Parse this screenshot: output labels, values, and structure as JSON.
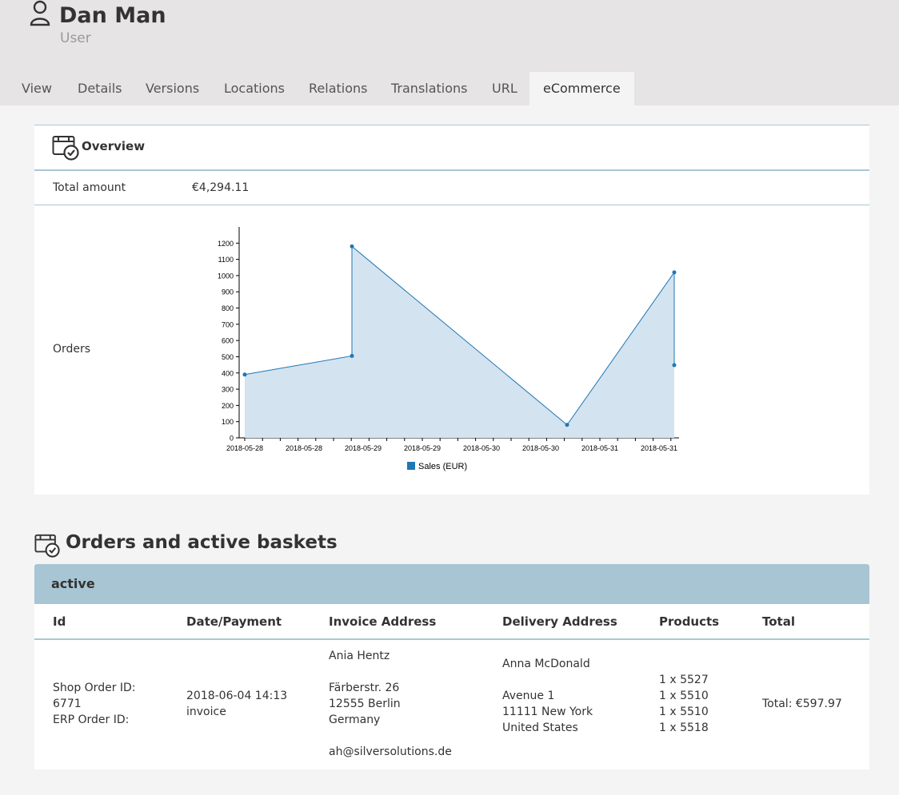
{
  "header": {
    "title": "Dan Man",
    "subtitle": "User",
    "icon": "user-icon"
  },
  "tabs": [
    {
      "label": "View",
      "active": false
    },
    {
      "label": "Details",
      "active": false
    },
    {
      "label": "Versions",
      "active": false
    },
    {
      "label": "Locations",
      "active": false
    },
    {
      "label": "Relations",
      "active": false
    },
    {
      "label": "Translations",
      "active": false
    },
    {
      "label": "URL",
      "active": false
    },
    {
      "label": "eCommerce",
      "active": true
    }
  ],
  "overview": {
    "title": "Overview",
    "total_label": "Total amount",
    "total_value": "€4,294.11",
    "orders_label": "Orders"
  },
  "chart_data": {
    "type": "area",
    "x_ticks": [
      "2018-05-28",
      "2018-05-28",
      "2018-05-29",
      "2018-05-29",
      "2018-05-30",
      "2018-05-30",
      "2018-05-31",
      "2018-05-31"
    ],
    "y_ticks": [
      0,
      100,
      200,
      300,
      400,
      500,
      600,
      700,
      800,
      900,
      1000,
      1100,
      1200
    ],
    "ylim": [
      0,
      1300
    ],
    "series": [
      {
        "name": "Sales (EUR)",
        "color": "#1f77b4",
        "fill": "#d3e3f0",
        "points": [
          {
            "x": "2018-05-28",
            "y": 390
          },
          {
            "x": "2018-05-29",
            "y": 505
          },
          {
            "x": "2018-05-29",
            "y": 1180
          },
          {
            "x": "2018-05-30",
            "y": 80
          },
          {
            "x": "2018-05-31",
            "y": 1020
          },
          {
            "x": "2018-05-31",
            "y": 448
          }
        ]
      }
    ],
    "legend": "bottom-center"
  },
  "orders_section": {
    "title": "Orders and active baskets",
    "group": "active",
    "columns": [
      "Id",
      "Date/Payment",
      "Invoice Address",
      "Delivery Address",
      "Products",
      "Total"
    ],
    "rows": [
      {
        "id_lines": [
          "Shop Order ID:",
          "6771",
          "ERP Order ID:"
        ],
        "date": "2018-06-04 14:13",
        "payment": "invoice",
        "invoice_lines": [
          "Ania Hentz",
          "",
          "Färberstr. 26",
          "12555 Berlin",
          "Germany",
          "",
          "ah@silversolutions.de"
        ],
        "delivery_lines": [
          "Anna McDonald",
          "",
          "Avenue 1",
          "11111 New York",
          "United States"
        ],
        "products": [
          "1 x 5527",
          "1 x 5510",
          "1 x 5510",
          "1 x 5518"
        ],
        "total": "Total: €597.97"
      }
    ]
  }
}
